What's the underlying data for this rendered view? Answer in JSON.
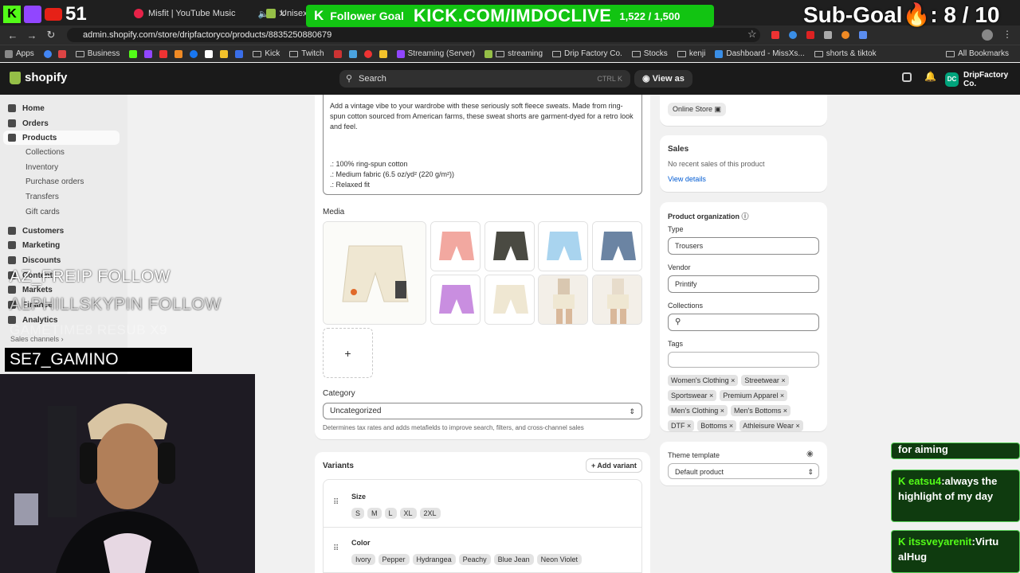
{
  "browser": {
    "tabs": [
      {
        "title": "Misfit | YouTube Music"
      },
      {
        "title": "Unisex Ga"
      }
    ],
    "url": "admin.shopify.com/store/dripfactoryco/products/8835250880679",
    "bookmarks": [
      "Apps",
      "Business",
      "Kick",
      "Twitch",
      "Streaming (Server)",
      "streaming",
      "Drip Factory Co.",
      "Stocks",
      "kenji",
      "Dashboard - MissXs...",
      "shorts & tiktok",
      "All Bookmarks"
    ]
  },
  "shopify": {
    "logo": "shopify",
    "search_placeholder": "Search",
    "search_shortcut": "CTRL K",
    "view_as": "View as",
    "store_name": "DripFactory Co.",
    "store_initials": "DC"
  },
  "sidebar": {
    "items": [
      "Home",
      "Orders",
      "Products",
      "Customers",
      "Marketing",
      "Discounts",
      "Content",
      "Markets",
      "Finance",
      "Analytics"
    ],
    "product_sub": [
      "Collections",
      "Inventory",
      "Purchase orders",
      "Transfers",
      "Gift cards"
    ],
    "sales_channels": "Sales channels"
  },
  "description": {
    "paragraph": "Add a vintage vibe to your wardrobe with these seriously soft fleece sweats. Made from ring-spun cotton sourced from American farms, these sweat shorts are garment-dyed for a retro look and feel.",
    "bullets": [
      ".: 100% ring-spun cotton",
      ".: Medium fabric (6.5 oz/yd² (220 g/m²))",
      ".: Relaxed fit"
    ]
  },
  "media": {
    "heading": "Media",
    "add": "+",
    "colors": [
      "#f2a8a0",
      "#4a4a42",
      "#a9d4ef",
      "#6b84a3",
      "#c98ee0",
      "#efe7d2"
    ]
  },
  "category": {
    "label": "Category",
    "value": "Uncategorized",
    "help": "Determines tax rates and adds metafields to improve search, filters, and cross-channel sales"
  },
  "variants": {
    "heading": "Variants",
    "add": "+ Add variant",
    "size_label": "Size",
    "sizes": [
      "S",
      "M",
      "L",
      "XL",
      "2XL"
    ],
    "color_label": "Color",
    "colors": [
      "Ivory",
      "Pepper",
      "Hydrangea",
      "Peachy",
      "Blue Jean",
      "Neon Violet"
    ]
  },
  "right": {
    "online_store": "Online Store",
    "sales_title": "Sales",
    "sales_text": "No recent sales of this product",
    "view_details": "View details",
    "org_title": "Product organization",
    "type_label": "Type",
    "type_value": "Trousers",
    "vendor_label": "Vendor",
    "vendor_value": "Printify",
    "collections_label": "Collections",
    "tags_label": "Tags",
    "tags": [
      "Women's Clothing",
      "Streetwear",
      "Sportswear",
      "Premium Apparel",
      "Men's Clothing",
      "Men's Bottoms",
      "DTF",
      "Bottoms",
      "Athleisure Wear"
    ],
    "theme_label": "Theme template",
    "theme_value": "Default product"
  },
  "stream": {
    "viewer_count": "51",
    "follower_goal_label": "Follower Goal",
    "kick_url": "KICK.COM/IMDOCLIVE",
    "goal_progress": "1,522 / 1,500",
    "sub_goal": "Sub-Goal",
    "sub_goal_count": ": 8 / 10",
    "follow_events": [
      "AZ_FREIP  FOLLOW",
      "ALPHILLSKYPIN  FOLLOW",
      "GAMETIME8  RESUB X9"
    ],
    "highlight_follow": "SE7_GAMINO  FOLLOW",
    "chat": [
      {
        "text": "for aiming"
      },
      {
        "user": "eatsu4",
        "text": "always the highlight of my day"
      },
      {
        "user": "itssveyarenit",
        "text": "Virtu alHug"
      }
    ]
  }
}
